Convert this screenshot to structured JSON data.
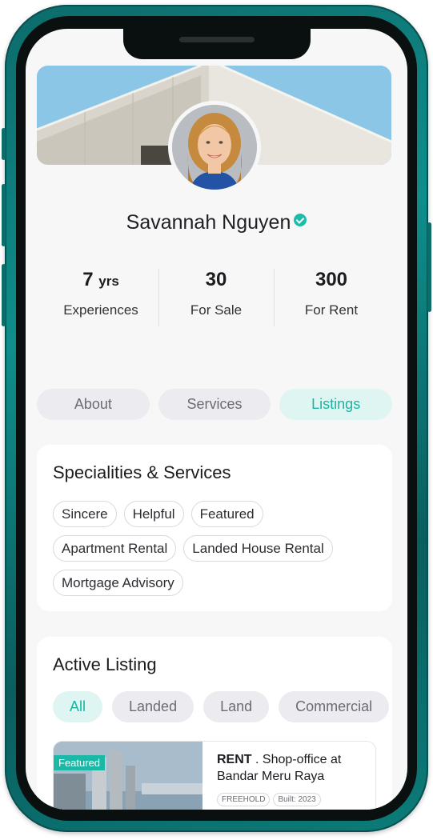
{
  "profile": {
    "name": "Savannah Nguyen",
    "verified": true
  },
  "stats": [
    {
      "value": "7",
      "unit": "yrs",
      "label": "Experiences"
    },
    {
      "value": "30",
      "unit": "",
      "label": "For Sale"
    },
    {
      "value": "300",
      "unit": "",
      "label": "For Rent"
    }
  ],
  "tabs": [
    {
      "label": "About",
      "active": false
    },
    {
      "label": "Services",
      "active": false
    },
    {
      "label": "Listings",
      "active": true
    }
  ],
  "services": {
    "title": "Specialities & Services",
    "chips": [
      "Sincere",
      "Helpful",
      "Featured",
      "Apartment Rental",
      "Landed House Rental",
      "Mortgage Advisory"
    ]
  },
  "listing": {
    "title": "Active Listing",
    "filters": [
      {
        "label": "All",
        "active": true
      },
      {
        "label": "Landed",
        "active": false
      },
      {
        "label": "Land",
        "active": false
      },
      {
        "label": "Commercial",
        "active": false
      }
    ],
    "items": [
      {
        "badge": "Featured",
        "type": "RENT",
        "title": ". Shop-office at Bandar Meru Raya",
        "tags": [
          "FREEHOLD",
          "Built: 2023"
        ]
      }
    ]
  },
  "colors": {
    "accent": "#1bb4a2",
    "accent_bg": "#dff5f1",
    "frame": "#0f8e8b"
  }
}
